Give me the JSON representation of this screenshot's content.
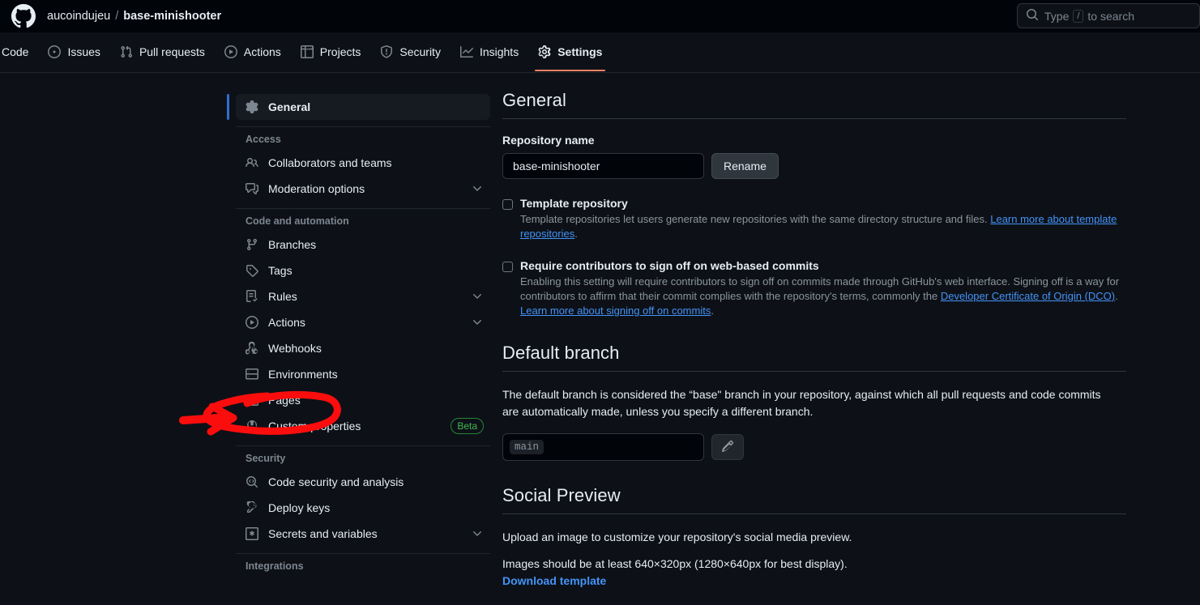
{
  "header": {
    "logo_icon": "github-mark-icon",
    "owner": "aucoindujeu",
    "separator": "/",
    "repo": "base-minishooter",
    "search": {
      "icon": "search-icon",
      "placeholder_prefix": "Type",
      "key_hint": "/",
      "placeholder_suffix": "to search"
    }
  },
  "repo_nav": {
    "tabs": [
      {
        "label": "Code",
        "icon": "code-icon",
        "active": false
      },
      {
        "label": "Issues",
        "icon": "issue-opened-icon",
        "active": false
      },
      {
        "label": "Pull requests",
        "icon": "git-pull-request-icon",
        "active": false
      },
      {
        "label": "Actions",
        "icon": "play-icon",
        "active": false
      },
      {
        "label": "Projects",
        "icon": "table-icon",
        "active": false
      },
      {
        "label": "Security",
        "icon": "shield-icon",
        "active": false
      },
      {
        "label": "Insights",
        "icon": "graph-icon",
        "active": false
      },
      {
        "label": "Settings",
        "icon": "gear-icon",
        "active": true
      }
    ],
    "active_underline_color": "#f78166"
  },
  "sidebar": {
    "selected_item": "General",
    "selected_accent_color": "#316dca",
    "general": {
      "label": "General",
      "icon": "gear-icon"
    },
    "sections": [
      {
        "heading": "Access",
        "items": [
          {
            "label": "Collaborators and teams",
            "icon": "people-icon",
            "chevron": false
          },
          {
            "label": "Moderation options",
            "icon": "comment-discussion-icon",
            "chevron": true
          }
        ]
      },
      {
        "heading": "Code and automation",
        "items": [
          {
            "label": "Branches",
            "icon": "git-branch-icon",
            "chevron": false
          },
          {
            "label": "Tags",
            "icon": "tag-icon",
            "chevron": false
          },
          {
            "label": "Rules",
            "icon": "rules-icon",
            "chevron": true
          },
          {
            "label": "Actions",
            "icon": "play-icon",
            "chevron": true
          },
          {
            "label": "Webhooks",
            "icon": "webhook-icon",
            "chevron": false
          },
          {
            "label": "Environments",
            "icon": "server-icon",
            "chevron": false
          },
          {
            "label": "Pages",
            "icon": "browser-icon",
            "chevron": false
          },
          {
            "label": "Custom properties",
            "icon": "tools-icon",
            "chevron": false,
            "badge": "Beta"
          }
        ]
      },
      {
        "heading": "Security",
        "items": [
          {
            "label": "Code security and analysis",
            "icon": "codescan-icon",
            "chevron": false
          },
          {
            "label": "Deploy keys",
            "icon": "key-icon",
            "chevron": false
          },
          {
            "label": "Secrets and variables",
            "icon": "secret-icon",
            "chevron": true
          }
        ]
      },
      {
        "heading": "Integrations",
        "items": []
      }
    ],
    "badge_color": "#3fb950"
  },
  "main": {
    "general": {
      "title": "General",
      "repository_name_label": "Repository name",
      "repository_name_value": "base-minishooter",
      "rename_button": "Rename",
      "template_repository": {
        "title": "Template repository",
        "desc_part1": "Template repositories let users generate new repositories with the same directory structure and files.",
        "link_text": "Learn more about template repositories",
        "desc_end": ".",
        "checked": false
      },
      "sign_off": {
        "title": "Require contributors to sign off on web-based commits",
        "desc_part1": "Enabling this setting will require contributors to sign off on commits made through GitHub's web interface. Signing off is a way for contributors to affirm that their commit complies with the repository's terms, commonly the",
        "link1": "Developer Certificate of Origin (DCO)",
        "desc_mid": ".",
        "link2": "Learn more about signing off on commits",
        "desc_end": ".",
        "checked": false
      }
    },
    "default_branch": {
      "title": "Default branch",
      "description": "The default branch is considered the “base\" branch in your repository, against which all pull requests and code commits are automatically made, unless you specify a different branch.",
      "branch_name": "main",
      "edit_icon": "pencil-icon"
    },
    "social_preview": {
      "title": "Social Preview",
      "line1": "Upload an image to customize your repository's social media preview.",
      "line2": "Images should be at least 640×320px (1280×640px for best display).",
      "download_link": "Download template"
    }
  },
  "annotation": {
    "color": "#fc0d0d",
    "shape": "ellipse-with-arrow",
    "target": "Pages"
  }
}
